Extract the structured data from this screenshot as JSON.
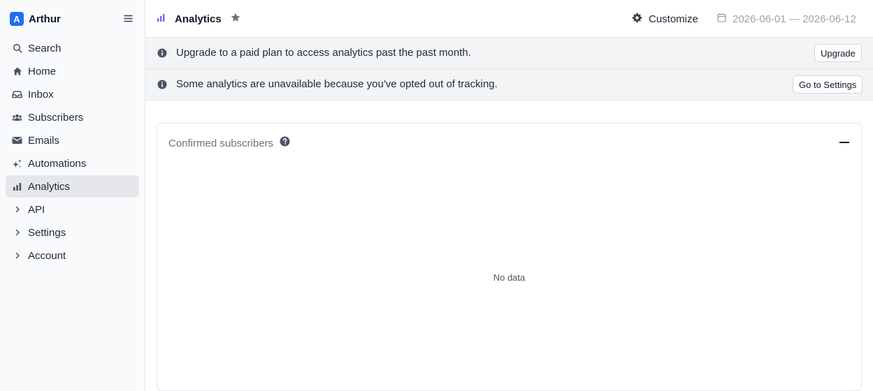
{
  "sidebar": {
    "brand": {
      "logo_letter": "A",
      "name": "Arthur",
      "color": "#1d6ff2"
    },
    "items": [
      {
        "label": "Search",
        "icon": "search-icon"
      },
      {
        "label": "Home",
        "icon": "home-icon"
      },
      {
        "label": "Inbox",
        "icon": "inbox-icon"
      },
      {
        "label": "Subscribers",
        "icon": "users-icon"
      },
      {
        "label": "Emails",
        "icon": "envelope-icon"
      },
      {
        "label": "Automations",
        "icon": "sparkles-icon"
      },
      {
        "label": "Analytics",
        "icon": "bar-chart-icon",
        "active": true
      },
      {
        "label": "API",
        "icon": "chevron-right-icon"
      },
      {
        "label": "Settings",
        "icon": "chevron-right-icon"
      },
      {
        "label": "Account",
        "icon": "chevron-right-icon"
      }
    ]
  },
  "header": {
    "title": "Analytics",
    "title_icon_color": "#8b5cf6",
    "customize_label": "Customize",
    "date_range": "2026-06-01 — 2026-06-12"
  },
  "banners": [
    {
      "message": "Upgrade to a paid plan to access analytics past the past month.",
      "button": "Upgrade"
    },
    {
      "message": "Some analytics are unavailable because you've opted out of tracking.",
      "button": "Go to Settings"
    }
  ],
  "card": {
    "title": "Confirmed subscribers",
    "empty_text": "No data"
  }
}
